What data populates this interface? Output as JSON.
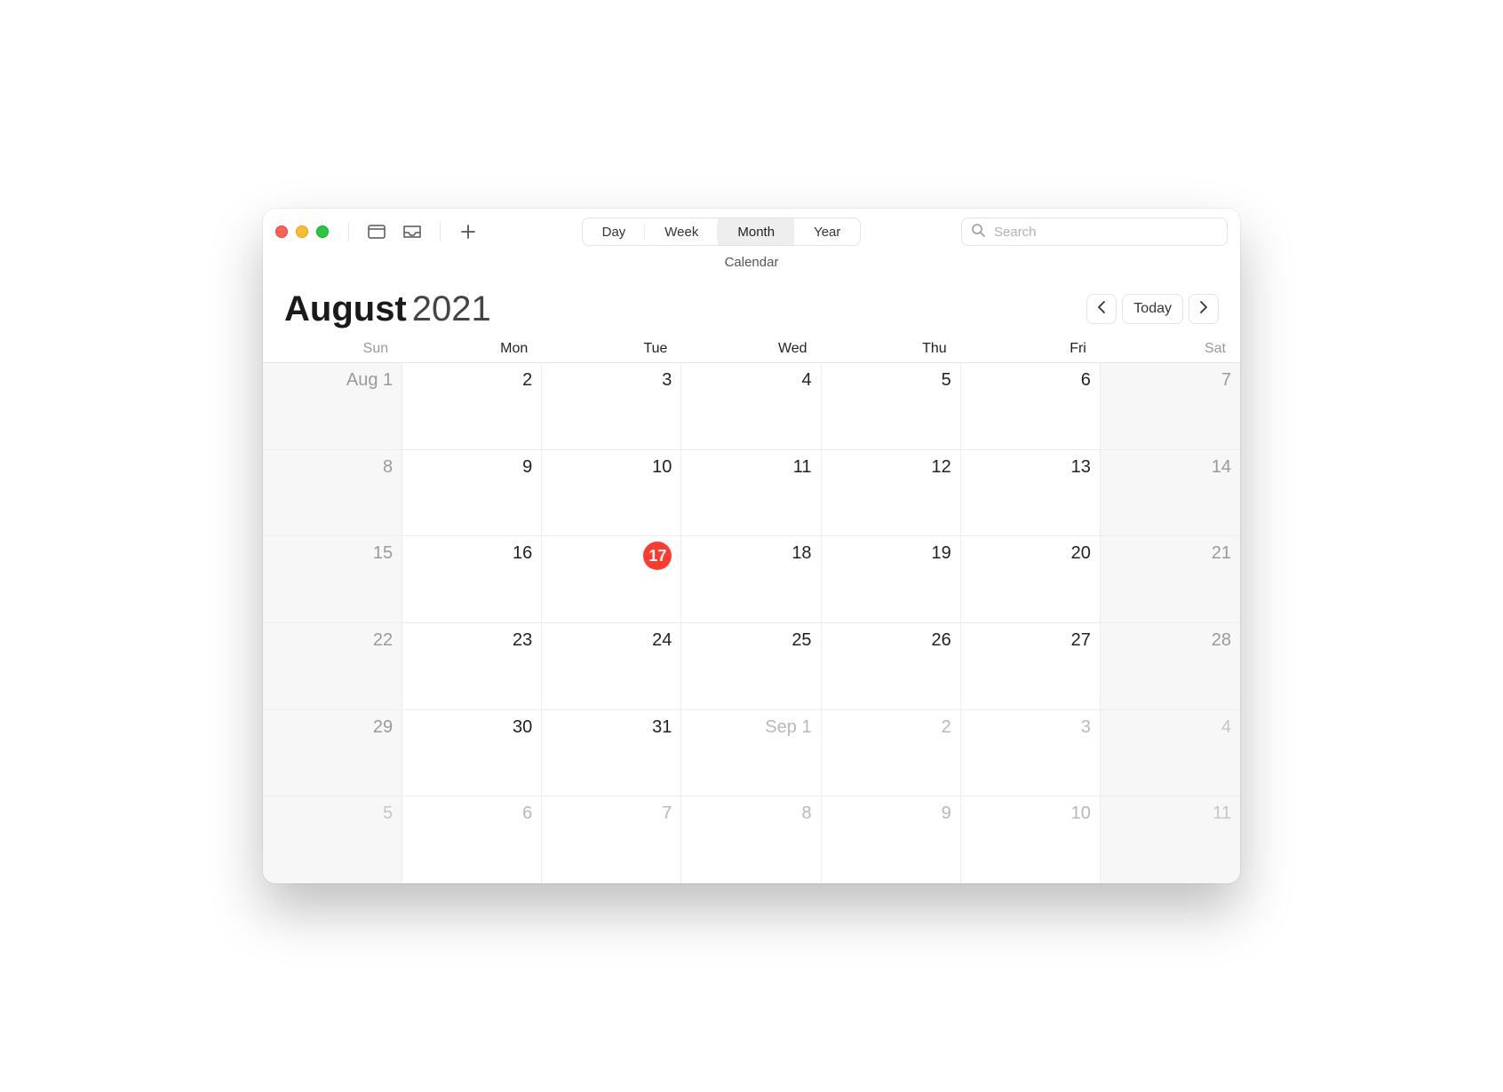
{
  "window": {
    "subtitle": "Calendar"
  },
  "toolbar": {
    "views": {
      "day": "Day",
      "week": "Week",
      "month": "Month",
      "year": "Year",
      "active": "month"
    },
    "search": {
      "placeholder": "Search"
    }
  },
  "header": {
    "month": "August",
    "year": "2021",
    "today_label": "Today"
  },
  "weekdays": [
    "Sun",
    "Mon",
    "Tue",
    "Wed",
    "Thu",
    "Fri",
    "Sat"
  ],
  "colors": {
    "today_badge": "#ff3b30"
  },
  "grid": {
    "today": "17",
    "weeks": [
      [
        {
          "label": "Aug 1",
          "outside": false,
          "weekend": true
        },
        {
          "label": "2"
        },
        {
          "label": "3"
        },
        {
          "label": "4"
        },
        {
          "label": "5"
        },
        {
          "label": "6"
        },
        {
          "label": "7",
          "weekend": true
        }
      ],
      [
        {
          "label": "8",
          "weekend": true
        },
        {
          "label": "9"
        },
        {
          "label": "10"
        },
        {
          "label": "11"
        },
        {
          "label": "12"
        },
        {
          "label": "13"
        },
        {
          "label": "14",
          "weekend": true
        }
      ],
      [
        {
          "label": "15",
          "weekend": true
        },
        {
          "label": "16"
        },
        {
          "label": "17",
          "today": true
        },
        {
          "label": "18"
        },
        {
          "label": "19"
        },
        {
          "label": "20"
        },
        {
          "label": "21",
          "weekend": true
        }
      ],
      [
        {
          "label": "22",
          "weekend": true
        },
        {
          "label": "23"
        },
        {
          "label": "24"
        },
        {
          "label": "25"
        },
        {
          "label": "26"
        },
        {
          "label": "27"
        },
        {
          "label": "28",
          "weekend": true
        }
      ],
      [
        {
          "label": "29",
          "weekend": true
        },
        {
          "label": "30"
        },
        {
          "label": "31"
        },
        {
          "label": "Sep 1",
          "outside": true
        },
        {
          "label": "2",
          "outside": true
        },
        {
          "label": "3",
          "outside": true
        },
        {
          "label": "4",
          "outside": true,
          "weekend": true
        }
      ],
      [
        {
          "label": "5",
          "outside": true,
          "weekend": true
        },
        {
          "label": "6",
          "outside": true
        },
        {
          "label": "7",
          "outside": true
        },
        {
          "label": "8",
          "outside": true
        },
        {
          "label": "9",
          "outside": true
        },
        {
          "label": "10",
          "outside": true
        },
        {
          "label": "11",
          "outside": true,
          "weekend": true
        }
      ]
    ]
  }
}
